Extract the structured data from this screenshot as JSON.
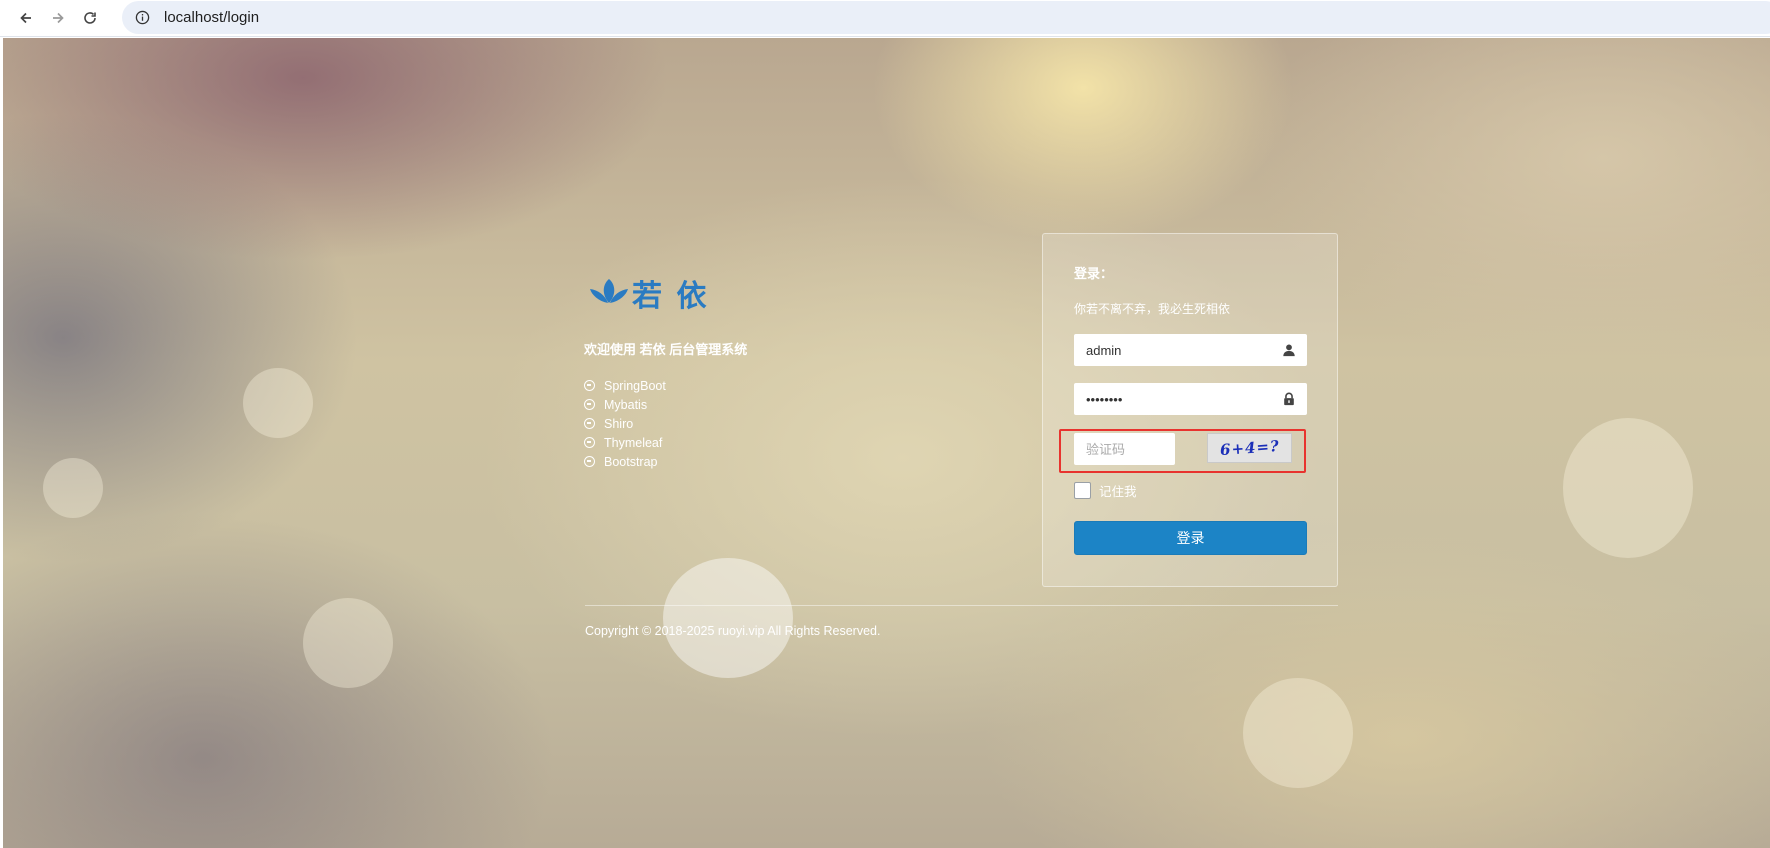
{
  "browser": {
    "url": "localhost/login",
    "back_icon": "arrow-left-icon",
    "forward_icon": "arrow-right-icon",
    "reload_icon": "reload-icon"
  },
  "brand": {
    "logo_text": "若 依",
    "welcome": "欢迎使用 若依 后台管理系统",
    "tech": [
      "SpringBoot",
      "Mybatis",
      "Shiro",
      "Thymeleaf",
      "Bootstrap"
    ]
  },
  "login": {
    "title": "登录：",
    "subtitle": "你若不离不弃，我必生死相依",
    "username_value": "admin",
    "password_value": "••••••••",
    "captcha_placeholder": "验证码",
    "captcha_text": "6+4=?",
    "remember_label": "记住我",
    "submit_label": "登录"
  },
  "footer": {
    "copyright": "Copyright © 2018-2025 ruoyi.vip All Rights Reserved."
  },
  "colors": {
    "primary_button": "#1c84c6",
    "highlight_border": "#e8332e",
    "logo_blue": "#2a7bc2"
  }
}
